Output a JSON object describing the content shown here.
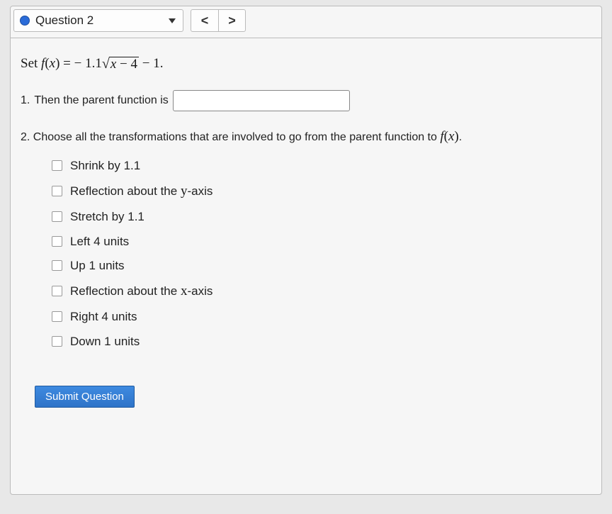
{
  "header": {
    "question_label": "Question 2",
    "prev_glyph": "<",
    "next_glyph": ">"
  },
  "problem": {
    "set_prefix": "Set ",
    "fn_lhs_f": "f",
    "fn_lhs_open": "(",
    "fn_lhs_x": "x",
    "fn_lhs_close": ")",
    "equals": " = ",
    "neg": " − ",
    "coeff": "1.1",
    "rad_x": "x",
    "rad_minus": " − ",
    "rad_four": "4",
    "tail_minus": " − ",
    "tail_one": "1",
    "period": "."
  },
  "part1": {
    "number": "1.",
    "text": "Then the parent function is",
    "input_value": ""
  },
  "part2": {
    "number": "2.",
    "text_a": "Choose all the transformations that are involved to go from the parent function to ",
    "fn_f": "f",
    "fn_open": "(",
    "fn_x": "x",
    "fn_close": ")",
    "period": ".",
    "options": [
      "Shrink by 1.1",
      "Reflection about the y-axis",
      "Stretch by 1.1",
      "Left 4 units",
      "Up 1 units",
      "Reflection about the x-axis",
      "Right 4 units",
      "Down 1 units"
    ],
    "option_y_axis_var": "y",
    "option_x_axis_var": "x"
  },
  "submit_label": "Submit Question"
}
